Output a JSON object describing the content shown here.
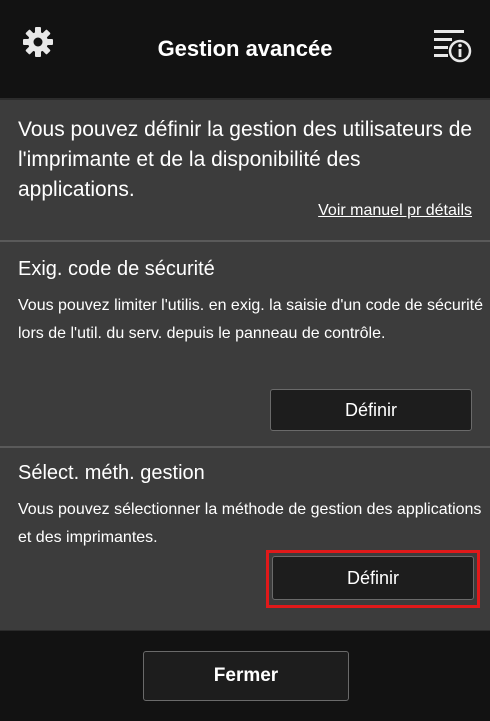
{
  "header": {
    "title": "Gestion avancée"
  },
  "intro": {
    "text": "Vous pouvez définir la gestion des utilisateurs de l'imprimante et de la disponibilité des applications.",
    "manual_link": "Voir manuel pr détails"
  },
  "security": {
    "title": "Exig. code de sécurité",
    "description": "Vous pouvez limiter l'utilis. en exig. la saisie d'un code de sécurité lors de l'util. du serv. depuis le panneau de contrôle.",
    "button": "Définir"
  },
  "management": {
    "title": "Sélect. méth. gestion",
    "description": "Vous pouvez sélectionner la méthode de gestion des applications et des imprimantes.",
    "button": "Définir"
  },
  "footer": {
    "close_label": "Fermer"
  },
  "colors": {
    "highlight": "#e0191a",
    "panel": "#3c3c3c",
    "bar": "#121212"
  },
  "icons": {
    "settings": "gear-icon",
    "menu_info": "menu-info-icon"
  }
}
